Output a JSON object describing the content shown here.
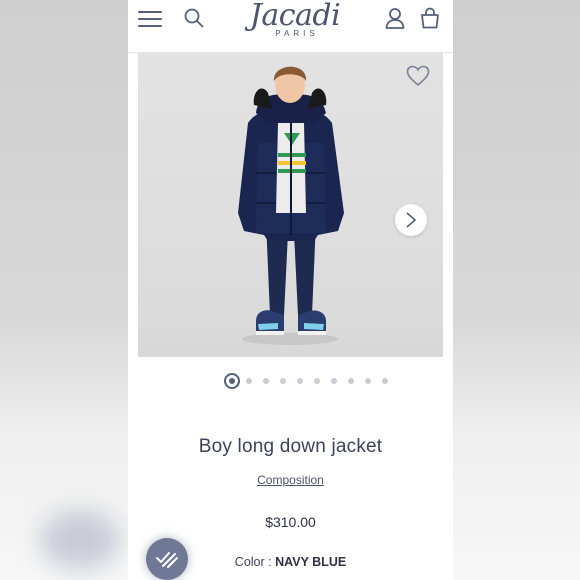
{
  "brand": {
    "logo": "Jacadi",
    "sub": "PARIS"
  },
  "header": {
    "menu_icon": "hamburger-menu-icon",
    "search_icon": "search-icon",
    "account_icon": "user-account-icon",
    "bag_icon": "shopping-bag-icon"
  },
  "gallery": {
    "wishlist_icon": "heart-icon",
    "next_icon": "chevron-right-icon",
    "image": "Boy wearing navy long down jacket with fur-trimmed hood, navy trousers and sneakers",
    "slide_count": 10,
    "active_slide": 1
  },
  "product": {
    "title": "Boy long down jacket",
    "composition_link": "Composition",
    "price": "$310.00",
    "color_label": "Color :",
    "color_value": "NAVY BLUE"
  },
  "colors": {
    "accent": "#55607a",
    "text": "#3c4257",
    "badge": "#6f7895"
  },
  "overlay": {
    "badge_icon": "seller-check-badge-icon"
  }
}
